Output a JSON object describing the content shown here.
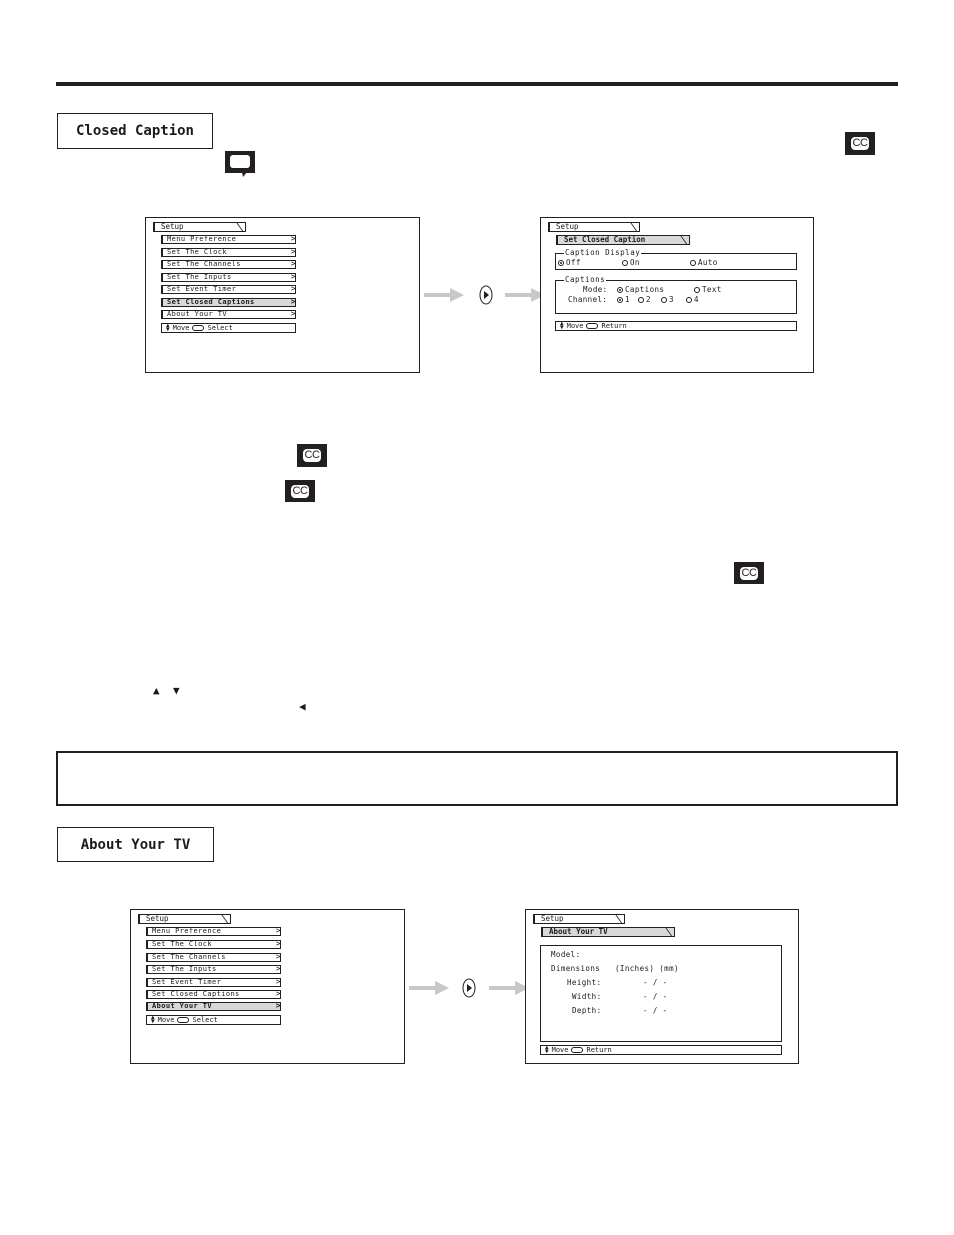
{
  "sections": {
    "closed_caption": {
      "title": "Closed Caption"
    },
    "about_tv": {
      "title": "About Your TV"
    }
  },
  "icons": {
    "cc": "CC",
    "up": "▲",
    "down": "▼",
    "left": "◀",
    "chevron": "〉"
  },
  "setup_menu": {
    "tab": "Setup",
    "items": [
      "Menu Preference",
      "Set The Clock",
      "Set The Channels",
      "Set The Inputs",
      "Set Event Timer",
      "Set Closed Captions",
      "About Your TV"
    ],
    "hint_move": "Move",
    "hint_select": "Select"
  },
  "cc_screen": {
    "tab": "Setup",
    "subtab": "Set Closed Caption",
    "caption_display": {
      "legend": "Caption Display",
      "options": [
        "Off",
        "On",
        "Auto"
      ],
      "selected": "Off"
    },
    "captions": {
      "legend": "Captions",
      "mode_label": "Mode:",
      "mode_options": [
        "Captions",
        "Text"
      ],
      "mode_selected": "Captions",
      "channel_label": "Channel:",
      "channel_options": [
        "1",
        "2",
        "3",
        "4"
      ],
      "channel_selected": "1"
    },
    "hint_move": "Move",
    "hint_return": "Return"
  },
  "about_screen": {
    "tab": "Setup",
    "subtab": "About Your TV",
    "model_label": "Model:",
    "dimensions_label": "Dimensions",
    "units": "(Inches) (mm)",
    "rows": [
      {
        "label": "Height:",
        "value": "- / -"
      },
      {
        "label": "Width:",
        "value": "- / -"
      },
      {
        "label": "Depth:",
        "value": "- / -"
      }
    ],
    "hint_move": "Move",
    "hint_return": "Return"
  }
}
